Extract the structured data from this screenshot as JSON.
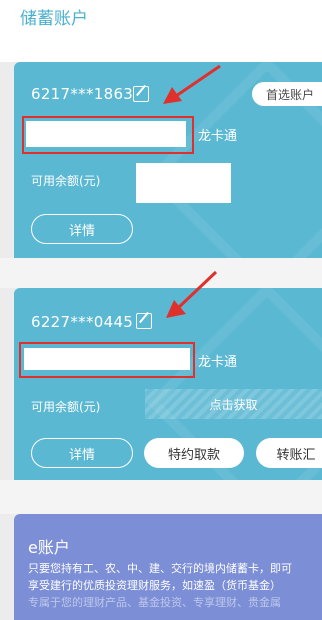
{
  "header": {
    "title": "储蓄账户"
  },
  "cards": [
    {
      "account": "6217***1863",
      "name_suffix": "龙卡通",
      "balance_label": "可用余额(元)",
      "tag": "首选账户",
      "buttons": [
        "详情"
      ]
    },
    {
      "account": "6227***0445",
      "name_suffix": "龙卡通",
      "balance_label": "可用余额(元)",
      "balance_action": "点击获取",
      "buttons": [
        "详情",
        "特约取款",
        "转账汇"
      ]
    }
  ],
  "eaccount": {
    "title": "e账户",
    "lines": [
      "只要您持有工、农、中、建、交行的境内储蓄卡，即可",
      "享受建行的优质投资理财服务，如速盈（货币基金）",
      "专属于您的理财产品、基金投资、专享理财、贵金属"
    ]
  },
  "colors": {
    "card": "#5bb8d3",
    "ecard": "#7c8ed6",
    "highlight": "#e0302c",
    "title": "#4ab0cf"
  }
}
